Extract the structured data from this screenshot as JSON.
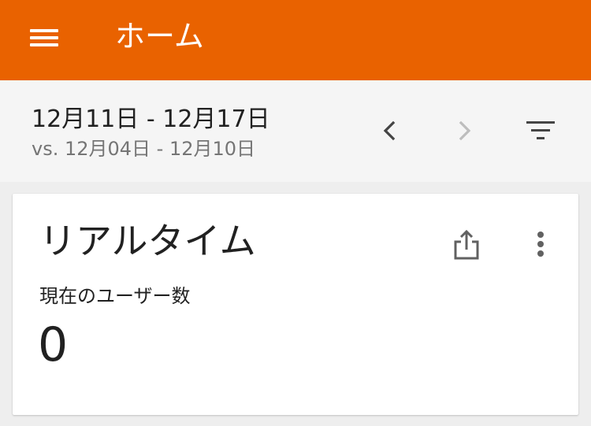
{
  "app_bar": {
    "title": "ホーム",
    "background_color": "#e96200",
    "menu_icon": "hamburger-menu-icon"
  },
  "date_range": {
    "primary": "12月11日 - 12月17日",
    "comparison": "vs. 12月04日 - 12月10日",
    "prev_icon": "chevron-left-icon",
    "next_icon": "chevron-right-icon",
    "next_enabled": false,
    "filter_icon": "filter-icon"
  },
  "realtime_card": {
    "title": "リアルタイム",
    "share_icon": "share-icon",
    "more_icon": "more-vertical-icon",
    "metric_label": "現在のユーザー数",
    "metric_value": "0"
  }
}
